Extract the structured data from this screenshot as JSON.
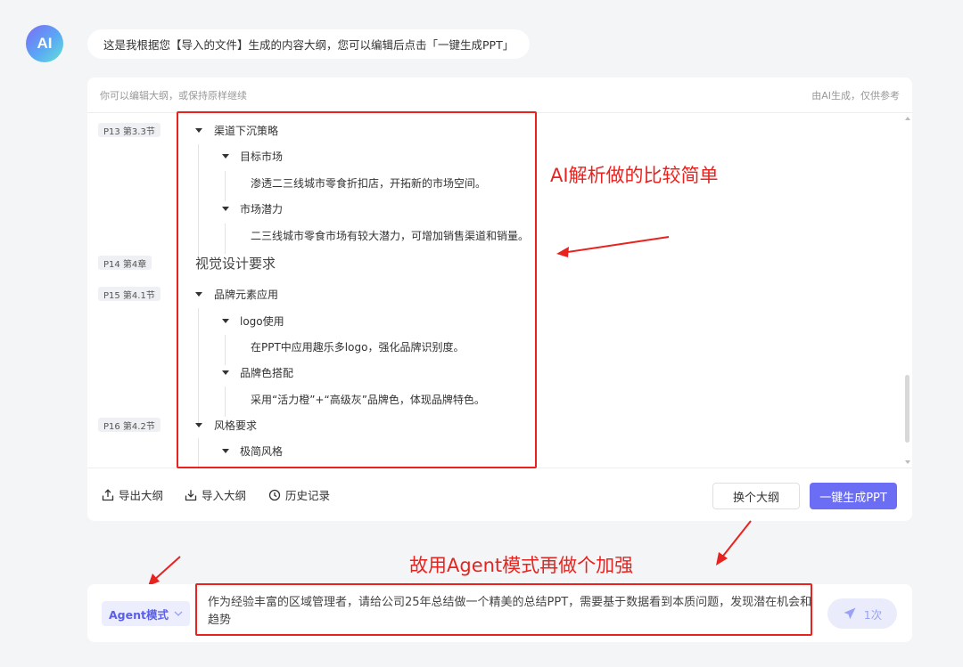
{
  "header": {
    "avatar_label": "AI",
    "message": "这是我根据您【导入的文件】生成的内容大纲，您可以编辑后点击「一键生成PPT」"
  },
  "panel": {
    "hint_left": "你可以编辑大纲，或保持原样继续",
    "hint_right": "由AI生成，仅供参考"
  },
  "outline": {
    "tags": [
      "P13 第3.3节",
      "P14 第4章",
      "P15 第4.1节",
      "P16 第4.2节"
    ],
    "nodes": [
      "渠道下沉策略",
      "目标市场",
      "渗透二三线城市零食折扣店，开拓新的市场空间。",
      "市场潜力",
      "二三线城市零食市场有较大潜力，可增加销售渠道和销量。",
      "视觉设计要求",
      "品牌元素应用",
      "logo使用",
      "在PPT中应用趣乐多logo，强化品牌识别度。",
      "品牌色搭配",
      "采用“活力橙”+“高级灰”品牌色，体现品牌特色。",
      "风格要求",
      "极简风格"
    ]
  },
  "footer": {
    "export_label": "导出大纲",
    "import_label": "导入大纲",
    "history_label": "历史记录",
    "change_label": "换个大纲",
    "generate_label": "一键生成PPT"
  },
  "annotations": {
    "note1": "AI解析做的比较简单",
    "note2": "故用Agent模式再做个加强"
  },
  "input": {
    "mode": "Agent模式",
    "prompt": "作为经验丰富的区域管理者，请给公司25年总结做一个精美的总结PPT，需要基于数据看到本质问题，发现潜在机会和趋势",
    "send_label": "1次"
  },
  "colors": {
    "accent": "#6b6ef5",
    "annotation": "#e8231f"
  }
}
